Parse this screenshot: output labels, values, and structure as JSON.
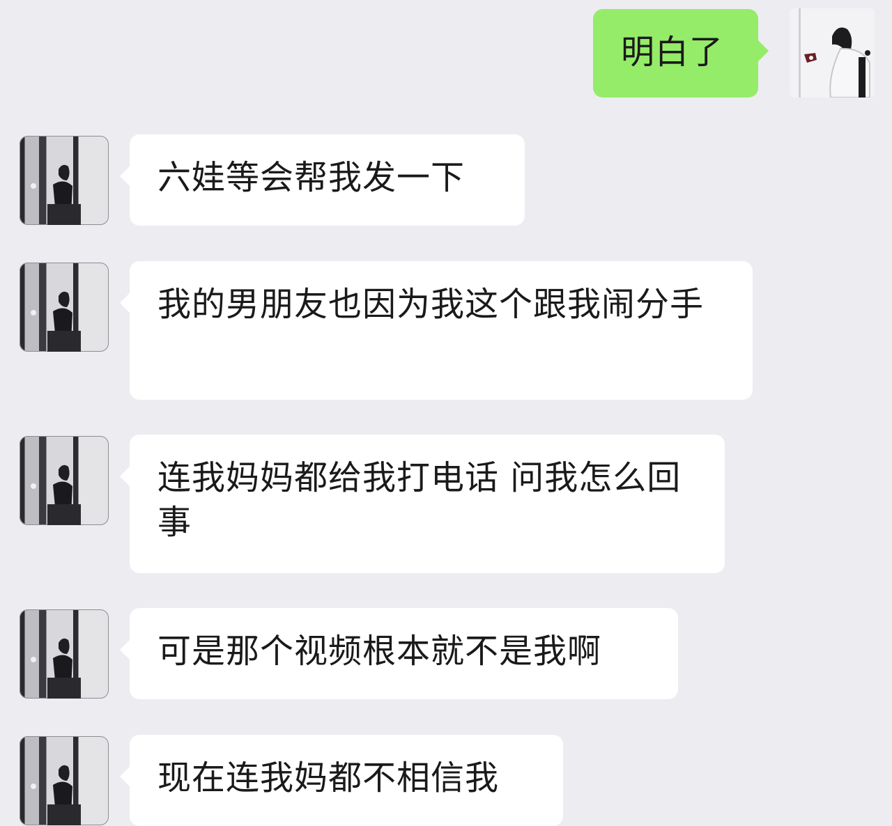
{
  "conversation": {
    "outgoing": {
      "text": "明白了"
    },
    "incoming": [
      {
        "text": "六娃等会帮我发一下"
      },
      {
        "text": "我的男朋友也因为我这个跟我闹分手"
      },
      {
        "text": "连我妈妈都给我打电话 问我怎么回事"
      },
      {
        "text": "可是那个视频根本就不是我啊"
      },
      {
        "text": "现在连我妈都不相信我"
      }
    ]
  },
  "colors": {
    "background": "#ececf1",
    "outgoing_bubble": "#95ec69",
    "incoming_bubble": "#ffffff"
  },
  "icons": {
    "self_avatar": "user-avatar-icon",
    "contact_avatar": "contact-avatar-icon"
  }
}
